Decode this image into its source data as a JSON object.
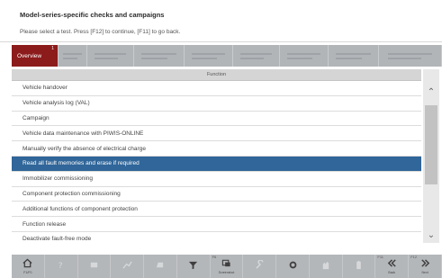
{
  "header": {
    "title": "Model-series-specific checks and campaigns",
    "instruction": "Please select a test. Press [F12] to continue, [F11] to go back."
  },
  "tabs": [
    {
      "label": "Overview",
      "marker": "1",
      "active": true
    },
    {
      "label": "",
      "active": false
    },
    {
      "label": "",
      "active": false
    },
    {
      "label": "",
      "active": false
    },
    {
      "label": "",
      "active": false
    },
    {
      "label": "",
      "active": false
    },
    {
      "label": "",
      "active": false
    },
    {
      "label": "",
      "active": false
    },
    {
      "label": "",
      "active": false
    }
  ],
  "table": {
    "column_header": "Function",
    "rows": [
      "Vehicle handover",
      "Vehicle analysis log (VAL)",
      "Campaign",
      "Vehicle data maintenance with PIWIS-ONLINE",
      "Manually verify the absence of electrical charge",
      "Read all fault memories and erase if required",
      "Immobilizer commissioning",
      "Component protection commissioning",
      "Additional functions of component protection",
      "Function release",
      "Deactivate fault-free mode"
    ],
    "selected_index": 5
  },
  "scrollbar": {
    "up_icon": "chevron-double-up-icon",
    "down_icon": "chevron-double-down-icon"
  },
  "toolbar": {
    "buttons": [
      {
        "icon": "home-icon",
        "label": "F1/F0",
        "fkey": "",
        "enabled": true
      },
      {
        "icon": "help-icon",
        "label": "",
        "fkey": "",
        "enabled": false
      },
      {
        "icon": "gateway-icon",
        "label": "",
        "fkey": "",
        "enabled": false
      },
      {
        "icon": "measurement-icon",
        "label": "",
        "fkey": "",
        "enabled": false
      },
      {
        "icon": "car-icon",
        "label": "",
        "fkey": "",
        "enabled": false
      },
      {
        "icon": "filter-icon",
        "label": "",
        "fkey": "",
        "enabled": true
      },
      {
        "icon": "screenshot-icon",
        "label": "Screenshot",
        "fkey": "F6",
        "enabled": true
      },
      {
        "icon": "wrench-icon",
        "label": "",
        "fkey": "",
        "enabled": false
      },
      {
        "icon": "settings-icon",
        "label": "",
        "fkey": "",
        "enabled": true
      },
      {
        "icon": "hand-icon",
        "label": "",
        "fkey": "",
        "enabled": false
      },
      {
        "icon": "battery-icon",
        "label": "",
        "fkey": "",
        "enabled": false
      },
      {
        "icon": "back-icon",
        "label": "Back",
        "fkey": "F11",
        "enabled": true
      },
      {
        "icon": "next-icon",
        "label": "Next",
        "fkey": "F12",
        "enabled": true
      }
    ]
  },
  "colors": {
    "tab_active": "#8c1b1b",
    "selected_row": "#306699",
    "tabbar": "#b5b8bb"
  }
}
